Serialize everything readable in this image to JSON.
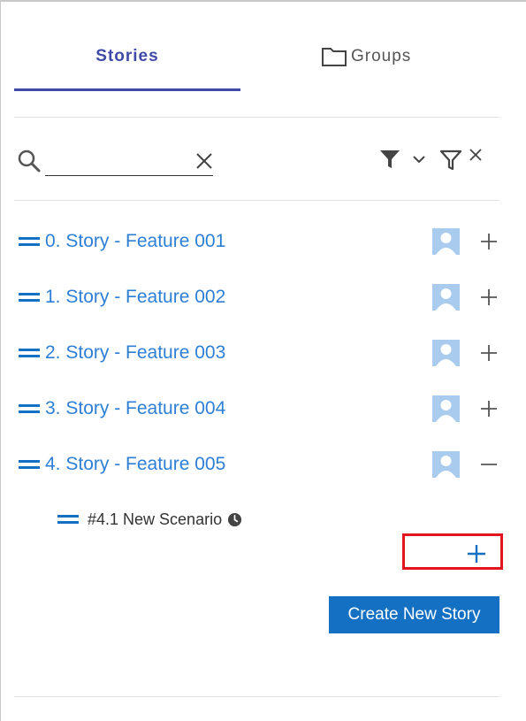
{
  "tabs": {
    "stories_label": "Stories",
    "groups_label": "Groups"
  },
  "search": {
    "value": "",
    "placeholder": ""
  },
  "stories": [
    {
      "label": "0. Story - Feature 001",
      "expanded": false
    },
    {
      "label": "1. Story - Feature 002",
      "expanded": false
    },
    {
      "label": "2. Story - Feature 003",
      "expanded": false
    },
    {
      "label": "3. Story - Feature 004",
      "expanded": false
    },
    {
      "label": "4. Story - Feature 005",
      "expanded": true
    }
  ],
  "scenarios": [
    {
      "label": "#4.1 New Scenario"
    }
  ],
  "create_button_label": "Create New Story",
  "icons": {
    "search": "search-icon",
    "clear": "close-icon",
    "filter": "filter-icon",
    "filter_clear": "filter-clear-icon",
    "drag": "drag-handle-icon",
    "avatar": "user-avatar-icon",
    "expand": "plus-icon",
    "collapse": "minus-icon",
    "clock": "clock-icon",
    "folder": "folder-icon"
  },
  "colors": {
    "accent": "#3f4aa8",
    "link": "#2d7fd6",
    "primary_button": "#1470c2",
    "avatar": "#a8cbee",
    "highlight": "#e3141d"
  }
}
